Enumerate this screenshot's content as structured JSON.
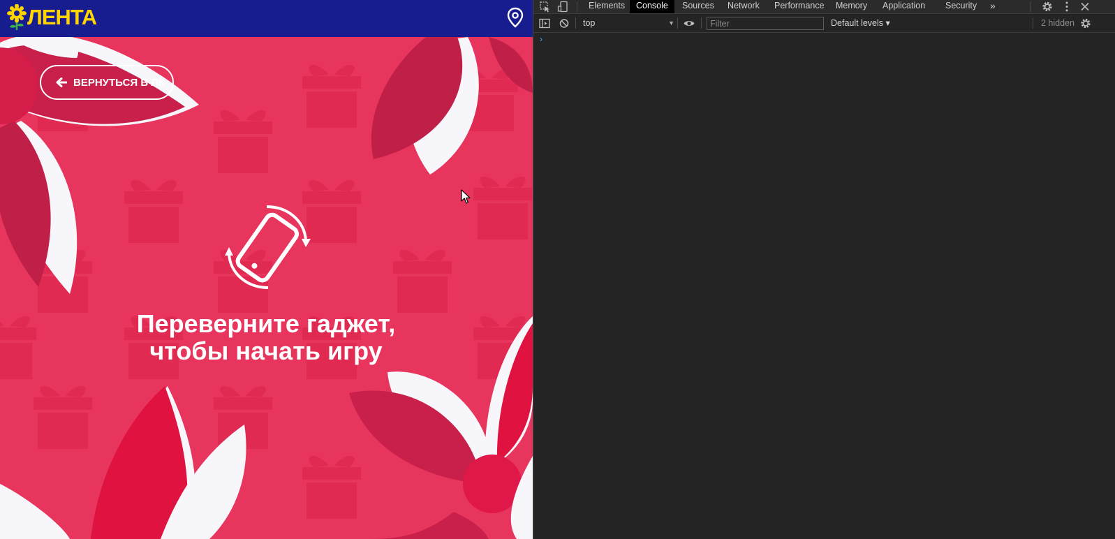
{
  "site": {
    "logo_text": "ЛЕНТА",
    "back_button_label": "ВЕРНУТЬСЯ В ЛК",
    "rotate_message_line1": "Переверните гаджет,",
    "rotate_message_line2": "чтобы начать игру",
    "colors": {
      "header_bg": "#171c8f",
      "logo_yellow": "#ffd500",
      "page_bg": "#e8355d",
      "gift_pattern": "#e02a52"
    }
  },
  "devtools": {
    "tabs": [
      {
        "label": "Elements",
        "active": false
      },
      {
        "label": "Console",
        "active": true
      },
      {
        "label": "Sources",
        "active": false
      },
      {
        "label": "Network",
        "active": false
      },
      {
        "label": "Performance",
        "active": false
      },
      {
        "label": "Memory",
        "active": false
      },
      {
        "label": "Application",
        "active": false
      },
      {
        "label": "Security",
        "active": false
      }
    ],
    "more_tabs_label": "»",
    "context": "top",
    "filter_placeholder": "Filter",
    "levels_label": "Default levels ▾",
    "hidden_count": "2 hidden",
    "prompt_symbol": "›",
    "icons": [
      "inspect-element-icon",
      "device-toolbar-icon",
      "settings-icon",
      "more-options-icon",
      "close-icon",
      "sidebar-toggle-icon",
      "clear-console-icon",
      "eye-icon",
      "console-settings-icon"
    ]
  }
}
